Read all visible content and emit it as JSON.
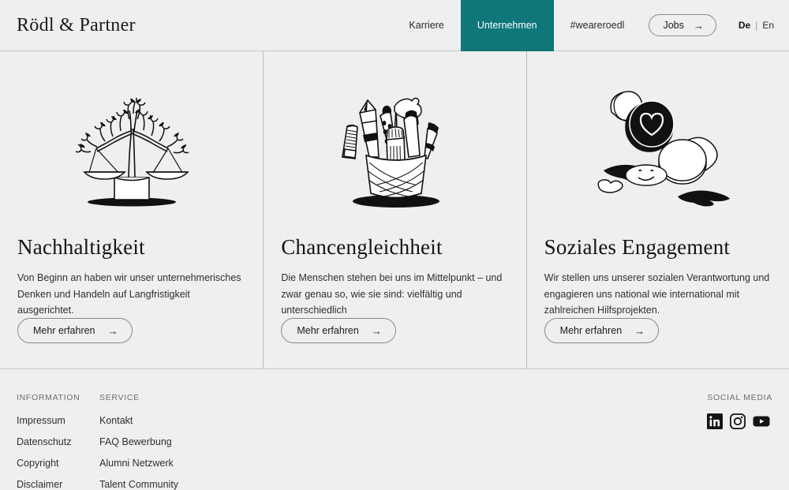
{
  "brand": {
    "logo": "Rödl & Partner"
  },
  "header": {
    "nav": [
      {
        "label": "Karriere",
        "active": false
      },
      {
        "label": "Unternehmen",
        "active": true
      },
      {
        "label": "#weareroedl",
        "active": false
      }
    ],
    "jobs_button": {
      "label": "Jobs",
      "icon": "arrow-right-icon"
    },
    "language": {
      "selected": "De",
      "separator": "|",
      "other": "En",
      "options": [
        "De",
        "En"
      ]
    },
    "accent_color": "#0f767a"
  },
  "cards": [
    {
      "illustration": "balance-scale-tree-icon",
      "title": "Nachhaltigkeit",
      "text": "Von Beginn an haben wir unser unternehmerisches Denken und Handeln auf Langfristigkeit ausgerichtet.",
      "cta": {
        "label": "Mehr erfahren",
        "icon": "arrow-right-icon"
      }
    },
    {
      "illustration": "pencil-cup-icon",
      "title": "Chancengleichheit",
      "text": "Die Menschen stehen bei uns im Mittelpunkt – und zwar genau so, wie sie sind: vielfältig und unterschiedlich",
      "cta": {
        "label": "Mehr erfahren",
        "icon": "arrow-right-icon"
      }
    },
    {
      "illustration": "rubber-stamps-heart-smiley-icon",
      "title": "Soziales Engagement",
      "text": "Wir stellen uns unserer sozialen Verantwortung und engagieren uns national wie international mit zahlreichen Hilfsprojekten.",
      "cta": {
        "label": "Mehr erfahren",
        "icon": "arrow-right-icon"
      }
    }
  ],
  "footer": {
    "columns": [
      {
        "heading": "INFORMATION",
        "links": [
          "Impressum",
          "Datenschutz",
          "Copyright",
          "Disclaimer"
        ]
      },
      {
        "heading": "SERVICE",
        "links": [
          "Kontakt",
          "FAQ Bewerbung",
          "Alumni Netzwerk",
          "Talent Community"
        ]
      }
    ],
    "social": {
      "heading": "SOCIAL MEDIA",
      "icons": [
        "linkedin-icon",
        "instagram-icon",
        "youtube-icon"
      ]
    }
  },
  "theme": {
    "page_background": "#efefef",
    "text_color": "#1a1a1a",
    "muted_text_color": "#6d6d6d",
    "divider_color": "#c9c9c9"
  }
}
